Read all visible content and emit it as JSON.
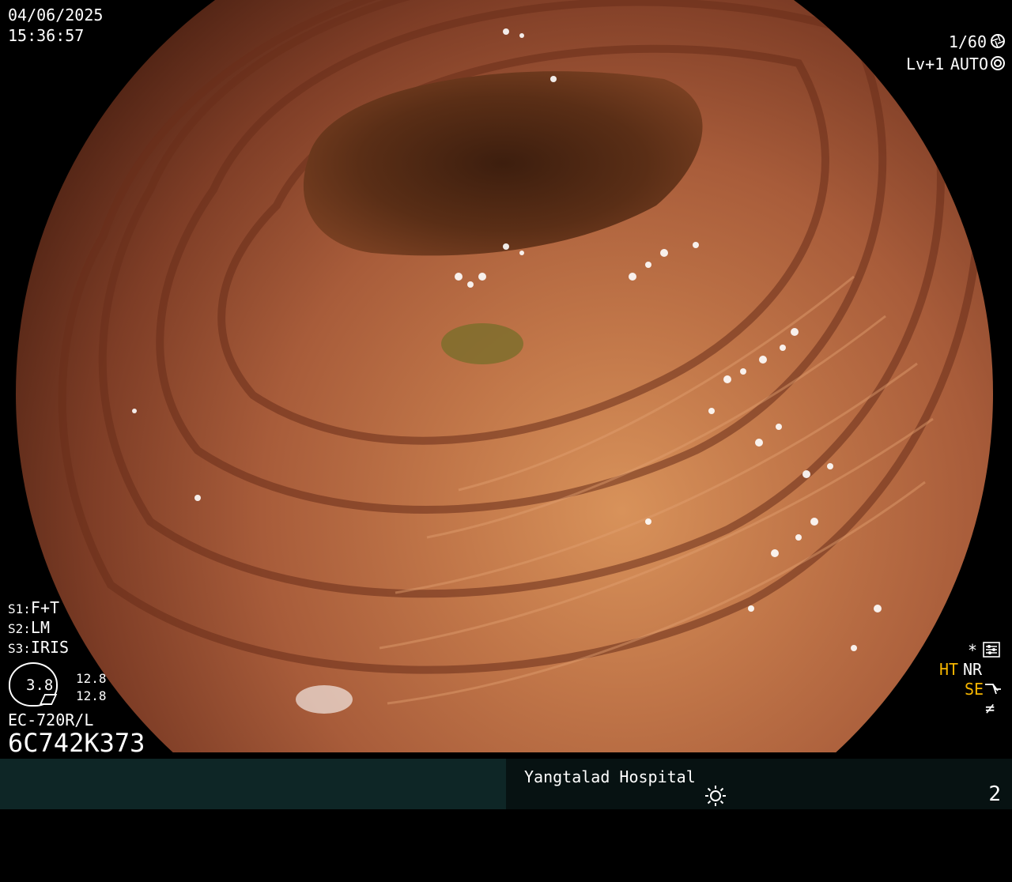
{
  "header": {
    "date": "04/06/2025",
    "time": "15:36:57"
  },
  "top_right": {
    "shutter": "1/60",
    "shutter_icon": "aperture-icon",
    "level": "Lv+1",
    "mode": "AUTO",
    "mode_icon": "iris-icon"
  },
  "settings": {
    "s1_key": "S1:",
    "s1_value": "F+T",
    "s2_key": "S2:",
    "s2_value": "LM",
    "s3_key": "S3:",
    "s3_value": "IRIS"
  },
  "scope": {
    "diameter": "3.8",
    "value_a": "12.8",
    "value_b": "12.8",
    "model": "EC-720R/L",
    "serial": "6C742K373"
  },
  "right_indicators": {
    "asterisk": "*",
    "menu_icon": "settings-sliders-icon",
    "ht": "HT",
    "nr": "NR",
    "se": "SE",
    "se_icon": "enhance-curve-icon",
    "not_equal": "≠"
  },
  "footer": {
    "hospital": "Yangtalad Hospital",
    "light_icon": "sun-icon",
    "page_number": "2"
  },
  "colors": {
    "indicator_yellow": "#f5b500",
    "bar_left": "#0e2626",
    "bar_right": "#071212"
  }
}
